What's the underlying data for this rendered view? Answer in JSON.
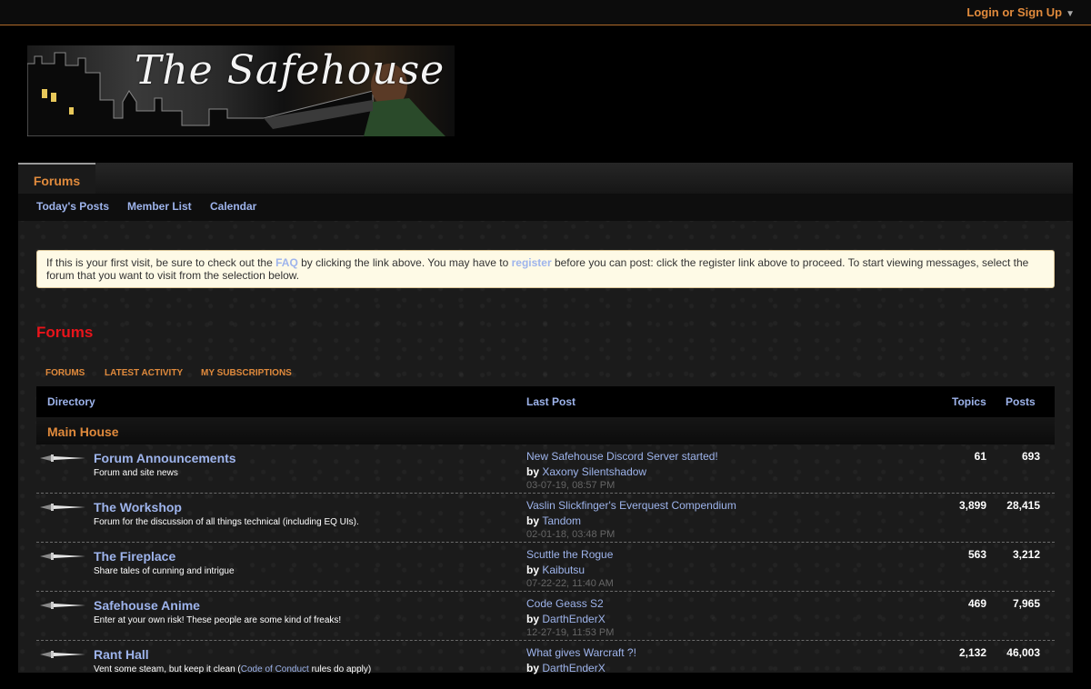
{
  "topbar": {
    "login_label": "Login or Sign Up",
    "caret": "▼"
  },
  "banner": {
    "title": "The Safehouse"
  },
  "nav": {
    "tab_label": "Forums",
    "links": [
      "Today's Posts",
      "Member List",
      "Calendar"
    ]
  },
  "notice": {
    "part1": "If this is your first visit, be sure to check out the ",
    "faq": "FAQ",
    "part2": " by clicking the link above. You may have to ",
    "register": "register",
    "part3": " before you can post: click the register link above to proceed. To start viewing messages, select the forum that you want to visit from the selection below."
  },
  "section_title": "Forums",
  "subtabs": [
    "FORUMS",
    "LATEST ACTIVITY",
    "MY SUBSCRIPTIONS"
  ],
  "table": {
    "headers": {
      "directory": "Directory",
      "last_post": "Last Post",
      "topics": "Topics",
      "posts": "Posts"
    },
    "category": "Main House",
    "rows": [
      {
        "name": "Forum Announcements",
        "desc": "Forum and site news",
        "last_title": "New Safehouse Discord Server started!",
        "by_label": "by",
        "last_user": "Xaxony Silentshadow",
        "last_date": "03-07-19, 08:57 PM",
        "topics": "61",
        "posts": "693"
      },
      {
        "name": "The Workshop",
        "desc": "Forum for the discussion of all things technical (including EQ UIs).",
        "last_title": "Vaslin Slickfinger's Everquest Compendium",
        "by_label": "by",
        "last_user": "Tandom",
        "last_date": "02-01-18, 03:48 PM",
        "topics": "3,899",
        "posts": "28,415"
      },
      {
        "name": "The Fireplace",
        "desc": "Share tales of cunning and intrigue",
        "last_title": "Scuttle the Rogue",
        "by_label": "by",
        "last_user": "Kaibutsu",
        "last_date": "07-22-22, 11:40 AM",
        "topics": "563",
        "posts": "3,212"
      },
      {
        "name": "Safehouse Anime",
        "desc": "Enter at your own risk! These people are some kind of freaks!",
        "last_title": "Code Geass S2",
        "by_label": "by",
        "last_user": "DarthEnderX",
        "last_date": "12-27-19, 11:53 PM",
        "topics": "469",
        "posts": "7,965"
      },
      {
        "name": "Rant Hall",
        "desc": "Vent some steam, but keep it clean (",
        "desc_link": "Code of Conduct",
        "desc_end": " rules do apply)",
        "last_title": "What gives Warcraft ?!",
        "by_label": "by",
        "last_user": "DarthEnderX",
        "last_date": "",
        "topics": "2,132",
        "posts": "46,003"
      }
    ]
  },
  "colors": {
    "accent_orange": "#e08a3c",
    "link_blue": "#9eb4ec",
    "heading_red": "#e8141b"
  }
}
